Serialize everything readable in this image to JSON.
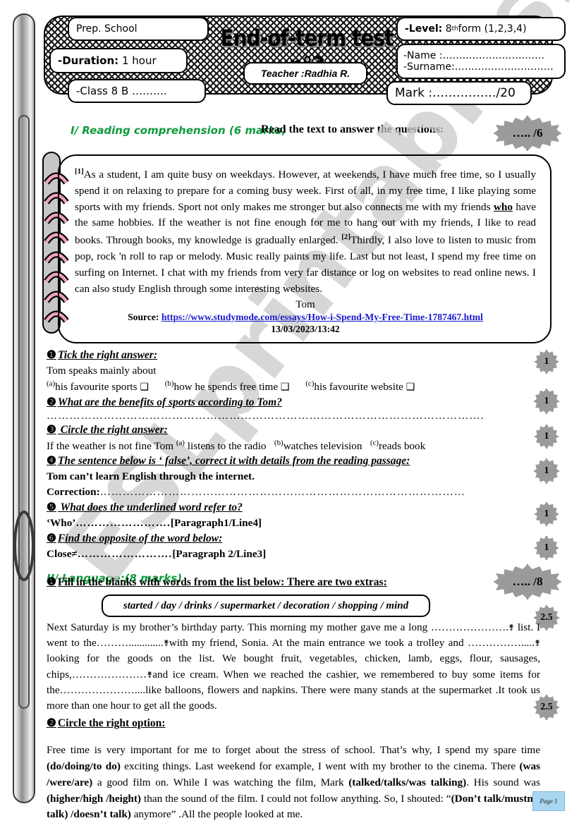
{
  "header": {
    "school": "Prep. School",
    "duration_label": "-Duration:",
    "duration_value": "1 hour",
    "class_label": "-Class 8 B ……….",
    "title": "End-of-term test n°2",
    "teacher": "Teacher :Radhia R.",
    "level_label": "-Level:",
    "level_value_pre": "8",
    "level_value_sup": "th",
    "level_value_post": " form (1,2,3,4)",
    "name_line": "-Name :………………………….",
    "surname_line": "-Surname:…………………………",
    "mark_line": "Mark :……………./20"
  },
  "reading": {
    "section_heading": "I/ Reading comprehension (6 marks)",
    "instruction": "Read the text to answer the questions:",
    "badge": "….. /6",
    "passage_p1_marker": "[1]",
    "passage_p1_a": "As a student, I am quite busy on weekdays. However, at weekends, I have much free time, so I usually spend it on relaxing to prepare for a coming busy week. First of all, in my free time, I like playing some sports with my friends. Sport not only makes me stronger but also connects me with my friends ",
    "passage_p1_underlined": "who",
    "passage_p1_b": " have the same hobbies.  If the weather is not fine enough for me to hang out with my friends, I like to read books. Through books, my knowledge is gradually enlarged. ",
    "passage_p2_marker": "[2]",
    "passage_p2": "Thirdly, I also love to listen to music from pop, rock 'n roll to rap or melody. Music really paints my life. Last but not least, I spend my free time on surfing on Internet. I chat with my friends from very far distance or log on websites to read online news. I can also study English through some interesting websites.",
    "author": "Tom",
    "source_label": "Source:",
    "source_url": "https://www.studymode.com/essays/How-i-Spend-My-Free-Time-1787467.html",
    "date": "13/03/2023/13:42"
  },
  "questions": [
    {
      "bullet": "❶",
      "title": "Tick the right answer:",
      "stem": "Tom speaks mainly about",
      "options": [
        {
          "label": "(a)",
          "text": "his  favourite sports ",
          "box": "❑"
        },
        {
          "label": "(b)",
          "text": "how he spends free time ",
          "box": "❑"
        },
        {
          "label": "(c)",
          "text": "his favourite website ",
          "box": "❑"
        }
      ],
      "badge": "1"
    },
    {
      "bullet": "❷",
      "title": "What are the benefits of sports according to Tom?",
      "answer_line": "…………………………………………………………………………………………………….",
      "badge": "1"
    },
    {
      "bullet": "❸",
      "title": " Circle the right answer:",
      "stem": "If the weather is not fine Tom ",
      "options": [
        {
          "label": "(a)",
          "text": " listens to the radio "
        },
        {
          "label": "(b)",
          "text": "watches television "
        },
        {
          "label": "(c)",
          "text": "reads book"
        }
      ],
      "badge": "1"
    },
    {
      "bullet": "❹",
      "title": "The sentence below is ‘ false’, correct it with details from the reading passage:",
      "stem": "Tom can’t learn English through the internet.",
      "correction_label": "Correction:",
      "correction_line": "……………………………………………………………………………………",
      "badge": "1"
    },
    {
      "bullet": "❺",
      "title": " What does the underlined word refer to?",
      "answer_prefix": "‘Who’",
      "answer_dots": "…………………….",
      "answer_ref": "[Paragraph1/Line4]",
      "badge": "1"
    },
    {
      "bullet": "❻",
      "title": "Find the opposite of the word below:",
      "answer_prefix": "Close≠",
      "answer_dots": "…………………….",
      "answer_ref": "[Paragraph 2/Line3]",
      "badge": "1"
    }
  ],
  "language": {
    "section_heading": "II/ Language:(8 marks)",
    "badge": "….. /8",
    "task1": {
      "bullet": "❶",
      "title": "Fill in the blanks with words from the list below: There are two extras:",
      "wordbank": "started / day / drinks / supermarket / decoration / shopping / mind",
      "badge": "2.5",
      "text_a": "Next Saturday is my brother’s birthday party. This morning my mother gave me a long ………………….",
      "text_b": " list. I went to the……….............",
      "text_c": "with my friend, Sonia. At the main entrance we took a trolley and …………….....",
      "text_d": " looking for the goods on the list. We bought fruit, vegetables, chicken, lamb, eggs, flour, sausages, chips,…………………",
      "text_e": "and ice cream. When we reached the cashier, we remembered to buy some items for the…………………....",
      "text_f": "like balloons, flowers and napkins. There were many stands at the supermarket .It took us more than one hour to get all the goods."
    },
    "task2": {
      "bullet": "❷",
      "title": "Circle the right option:",
      "badge": "2.5",
      "text_a": "Free time is very important for me to forget about the stress of school. That’s why, I spend my spare time ",
      "opt1": "(do/doing/to do)",
      "text_b": " exciting things. Last weekend for example, I went with my brother to the cinema. There ",
      "opt2": "(was /were/are)",
      "text_c": " a good film on. While I was watching the film, Mark ",
      "opt3": "(talked/talks/was talking)",
      "text_d": ". His sound was ",
      "opt4": "(higher/high /height)",
      "text_e": " than the sound of the film. I could not follow anything. So, I shouted: “",
      "opt5": "(Don’t talk/mustn’t talk) /doesn’t talk)",
      "text_f": " anymore” .All the people looked at me."
    }
  },
  "footer": {
    "page_note": "Page 1"
  },
  "watermark": {
    "text": "ESLprintables.com"
  },
  "colors": {
    "section_green": "#0f9b3d",
    "badge_gray": "#9a9a9a",
    "link_blue": "#1a1ad0",
    "spiral_pink": "#f0a0c0",
    "note_blue": "#a9d6f0"
  }
}
